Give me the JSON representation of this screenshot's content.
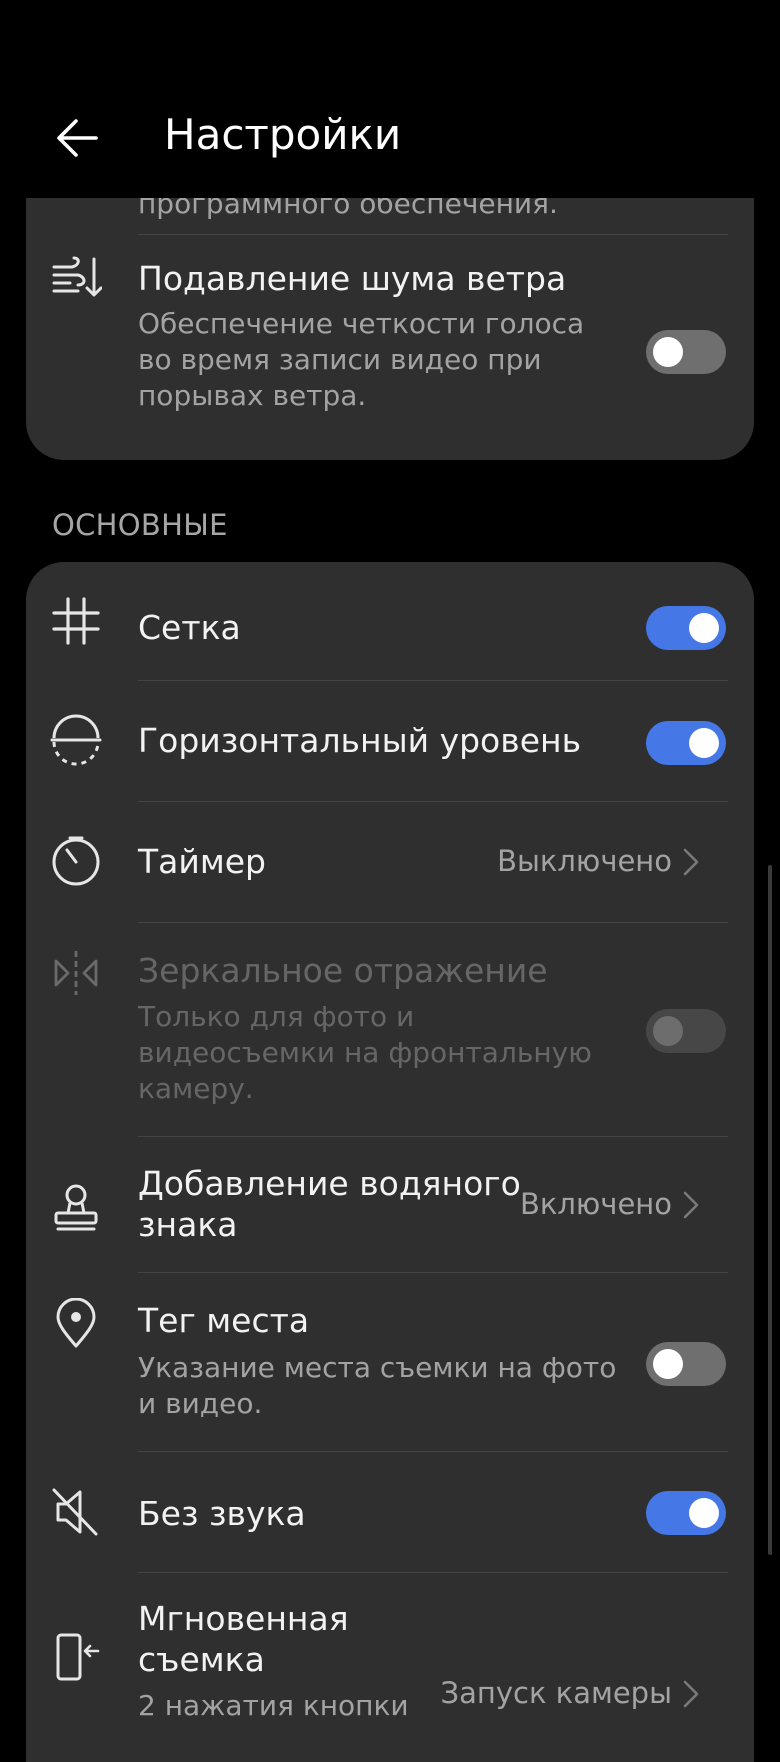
{
  "header": {
    "title": "Настройки"
  },
  "top_card": {
    "partial_text": "программного обеспечения.",
    "wind": {
      "title": "Подавление шума ветра",
      "subtitle_lines": [
        "Обеспечение четкости голоса",
        "во время записи видео при",
        "порывах ветра."
      ],
      "enabled": false
    }
  },
  "section": {
    "title": "ОСНОВНЫЕ"
  },
  "rows": {
    "grid": {
      "title": "Сетка",
      "enabled": true
    },
    "level": {
      "title": "Горизонтальный уровень",
      "enabled": true
    },
    "timer": {
      "title": "Таймер",
      "value": "Выключено"
    },
    "mirror": {
      "title": "Зеркальное отражение",
      "subtitle_lines": [
        "Только для фото и",
        "видеосъемки на фронтальную",
        "камеру."
      ],
      "enabled": false
    },
    "watermark": {
      "title_lines": [
        "Добавление водяного",
        "знака"
      ],
      "value": "Включено"
    },
    "location": {
      "title": "Тег места",
      "subtitle_lines": [
        "Указание места съемки на фото",
        "и видео."
      ],
      "enabled": false
    },
    "mute": {
      "title": "Без звука",
      "enabled": true
    },
    "snapshot": {
      "title_lines": [
        "Мгновенная",
        "съемка"
      ],
      "subtitle": "2 нажатия кнопки",
      "value": "Запуск камеры"
    }
  },
  "colors": {
    "accent": "#4577e6",
    "card": "#2f2f2f",
    "background": "#000000"
  },
  "icons": [
    "back-arrow-icon",
    "wind-icon",
    "grid-icon",
    "level-icon",
    "timer-icon",
    "mirror-icon",
    "stamp-icon",
    "location-pin-icon",
    "mute-icon",
    "phone-press-icon",
    "chevron-right-icon"
  ]
}
